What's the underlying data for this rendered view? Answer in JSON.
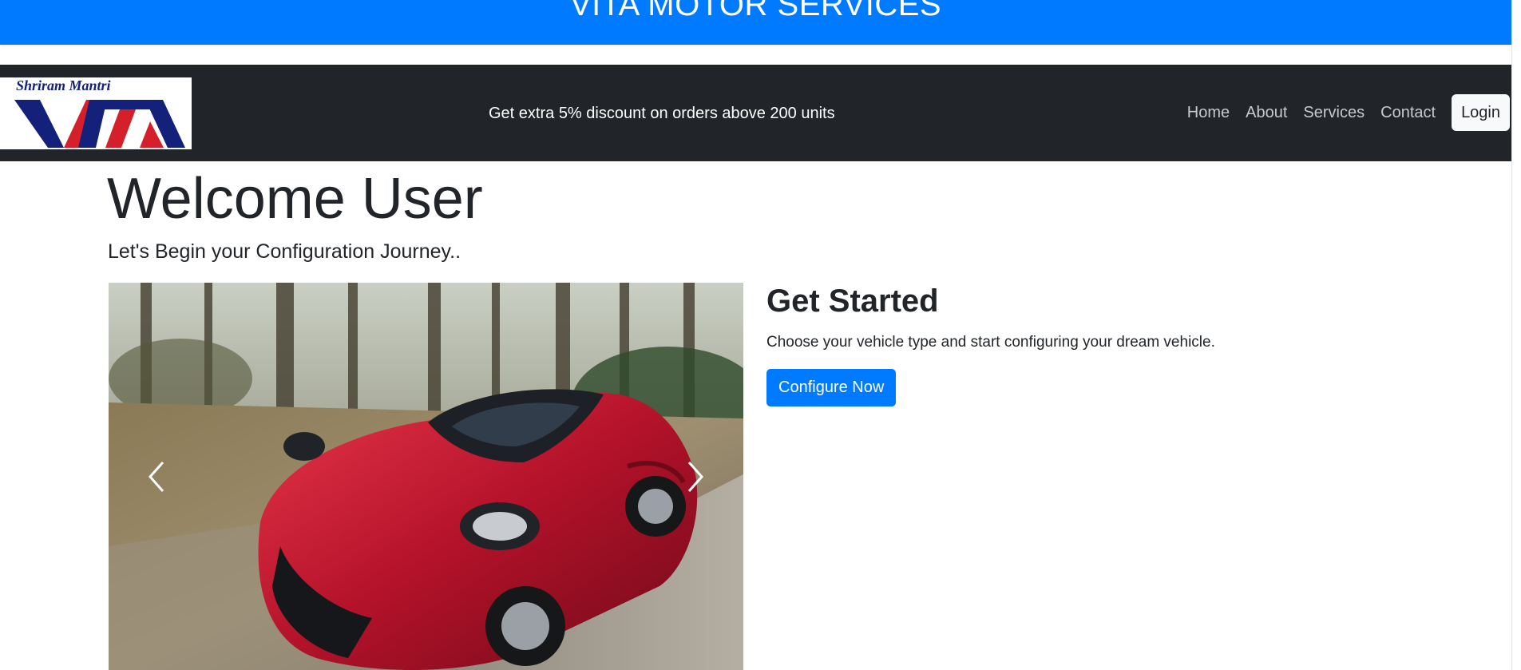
{
  "banner": {
    "title": "VITA MOTOR SERVICES"
  },
  "navbar": {
    "logo": {
      "top_text": "Shriram Mantri",
      "main_text": "VITA"
    },
    "promo": "Get extra 5% discount on orders above 200 units",
    "links": [
      "Home",
      "About",
      "Services",
      "Contact"
    ],
    "login_label": "Login"
  },
  "hero": {
    "title": "Welcome User",
    "subtitle": "Let's Begin your Configuration Journey.."
  },
  "carousel": {
    "prev_icon": "chevron-left-icon",
    "next_icon": "chevron-right-icon"
  },
  "get_started": {
    "title": "Get Started",
    "text": "Choose your vehicle type and start configuring your dream vehicle.",
    "button_label": "Configure Now"
  },
  "colors": {
    "brand_blue": "#007bff",
    "navbar_dark": "#212529",
    "logo_navy": "#14217a",
    "logo_red": "#d4202a"
  }
}
